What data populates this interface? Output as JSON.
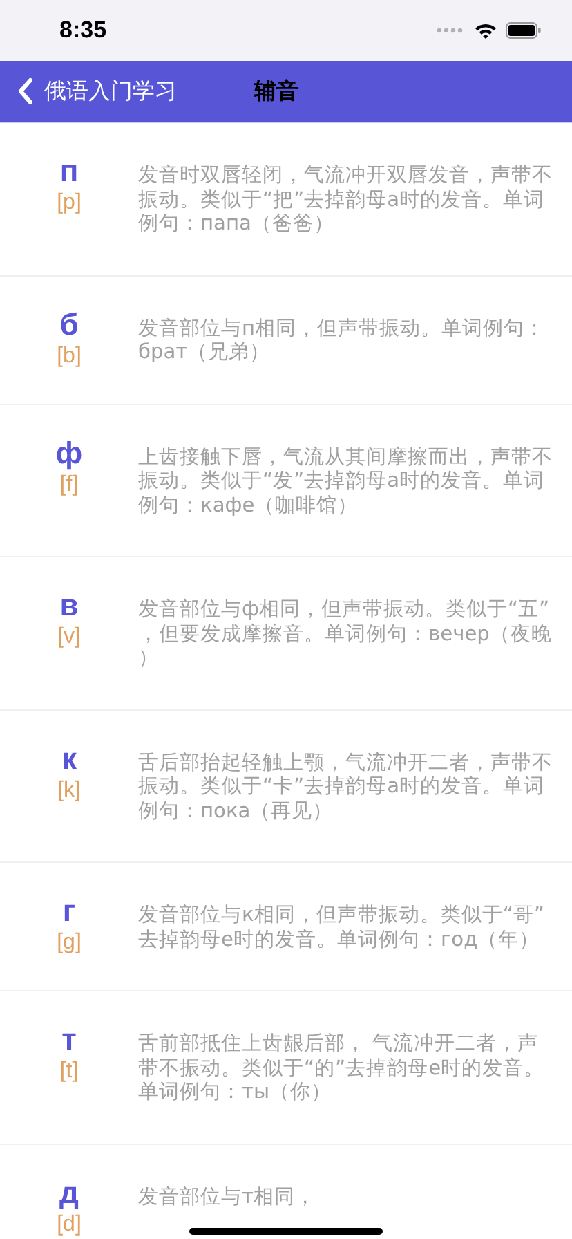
{
  "status_bar": {
    "time": "8:35"
  },
  "nav": {
    "back_label": "俄语入门学习",
    "title": "辅音"
  },
  "items": [
    {
      "letter": "п",
      "phonetic": "[p]",
      "description": "发音时双唇轻闭，气流冲开双唇发音，声带不振动。类似于“把”去掉韵母a时的发音。单词例句：папа（爸爸）"
    },
    {
      "letter": "б",
      "phonetic": "[b]",
      "description": "发音部位与п相同，但声带振动。单词例句：брат（兄弟）"
    },
    {
      "letter": "ф",
      "phonetic": "[f]",
      "description": "上齿接触下唇，气流从其间摩擦而出，声带不振动。类似于“发”去掉韵母a时的发音。单词例句：кафе（咖啡馆）"
    },
    {
      "letter": "в",
      "phonetic": "[v]",
      "description": "发音部位与ф相同，但声带振动。类似于“五”，但要发成摩擦音。单词例句：вечер（夜晚）"
    },
    {
      "letter": "к",
      "phonetic": "[k]",
      "description": "舌后部抬起轻触上颚，气流冲开二者，声带不振动。类似于“卡”去掉韵母a时的发音。单词例句：пока（再见）"
    },
    {
      "letter": "г",
      "phonetic": "[g]",
      "description": "发音部位与к相同，但声带振动。类似于“哥”去掉韵母e时的发音。单词例句：год（年）"
    },
    {
      "letter": "т",
      "phonetic": "[t]",
      "description": "舌前部抵住上齿龈后部， 气流冲开二者，声带不振动。类似于“的”去掉韵母e时的发音。单词例句：ты（你）"
    },
    {
      "letter": "д",
      "phonetic": "[d]",
      "description": "发音部位与т相同，"
    }
  ]
}
